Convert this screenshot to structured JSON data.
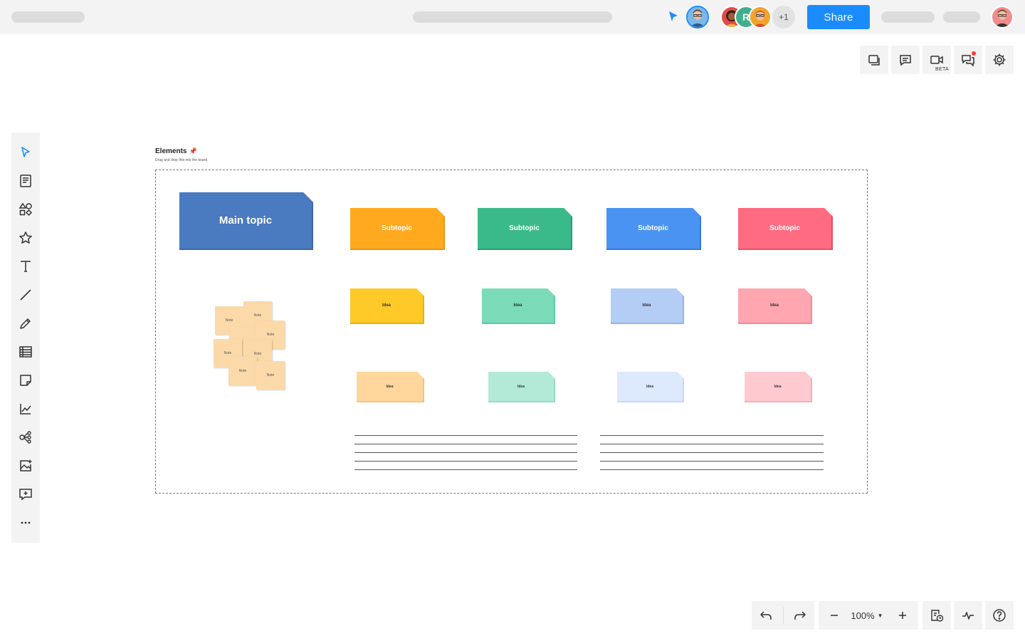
{
  "header": {
    "share_label": "Share",
    "collaborators_more": "+1",
    "collaborator_initial": "R"
  },
  "right_toolbar": {
    "video_badge": "BETA"
  },
  "board": {
    "title": "Elements",
    "subtitle": "Drag and drop this into the board",
    "main_topic": "Main topic",
    "subtopics": [
      {
        "label": "Subtopic",
        "color": "#ffa91f",
        "shadow": "#e89510"
      },
      {
        "label": "Subtopic",
        "color": "#3aba8a",
        "shadow": "#2a9d73"
      },
      {
        "label": "Subtopic",
        "color": "#4b93f2",
        "shadow": "#3478d8"
      },
      {
        "label": "Subtopic",
        "color": "#ff6b81",
        "shadow": "#e25066"
      }
    ],
    "ideas_row1": [
      {
        "label": "Idea",
        "color": "#ffc928"
      },
      {
        "label": "Idea",
        "color": "#7bdbb9"
      },
      {
        "label": "Idea",
        "color": "#b3cdf5"
      },
      {
        "label": "Idea",
        "color": "#ffa6b1"
      }
    ],
    "ideas_row2": [
      {
        "label": "Idea",
        "color": "#ffd79c"
      },
      {
        "label": "Idea",
        "color": "#b2ead7"
      },
      {
        "label": "Idea",
        "color": "#dde9fd"
      },
      {
        "label": "Idea",
        "color": "#ffc9d0"
      }
    ],
    "notes": [
      "Note",
      "Note",
      "Note",
      "Note",
      "Note",
      "Note",
      "Note",
      "Note",
      "Note"
    ]
  },
  "bottom_toolbar": {
    "zoom": "100%"
  },
  "colors": {
    "accent": "#1a8cff",
    "main_topic": "#4a7abf",
    "toolbar_bg": "#f3f3f3"
  }
}
